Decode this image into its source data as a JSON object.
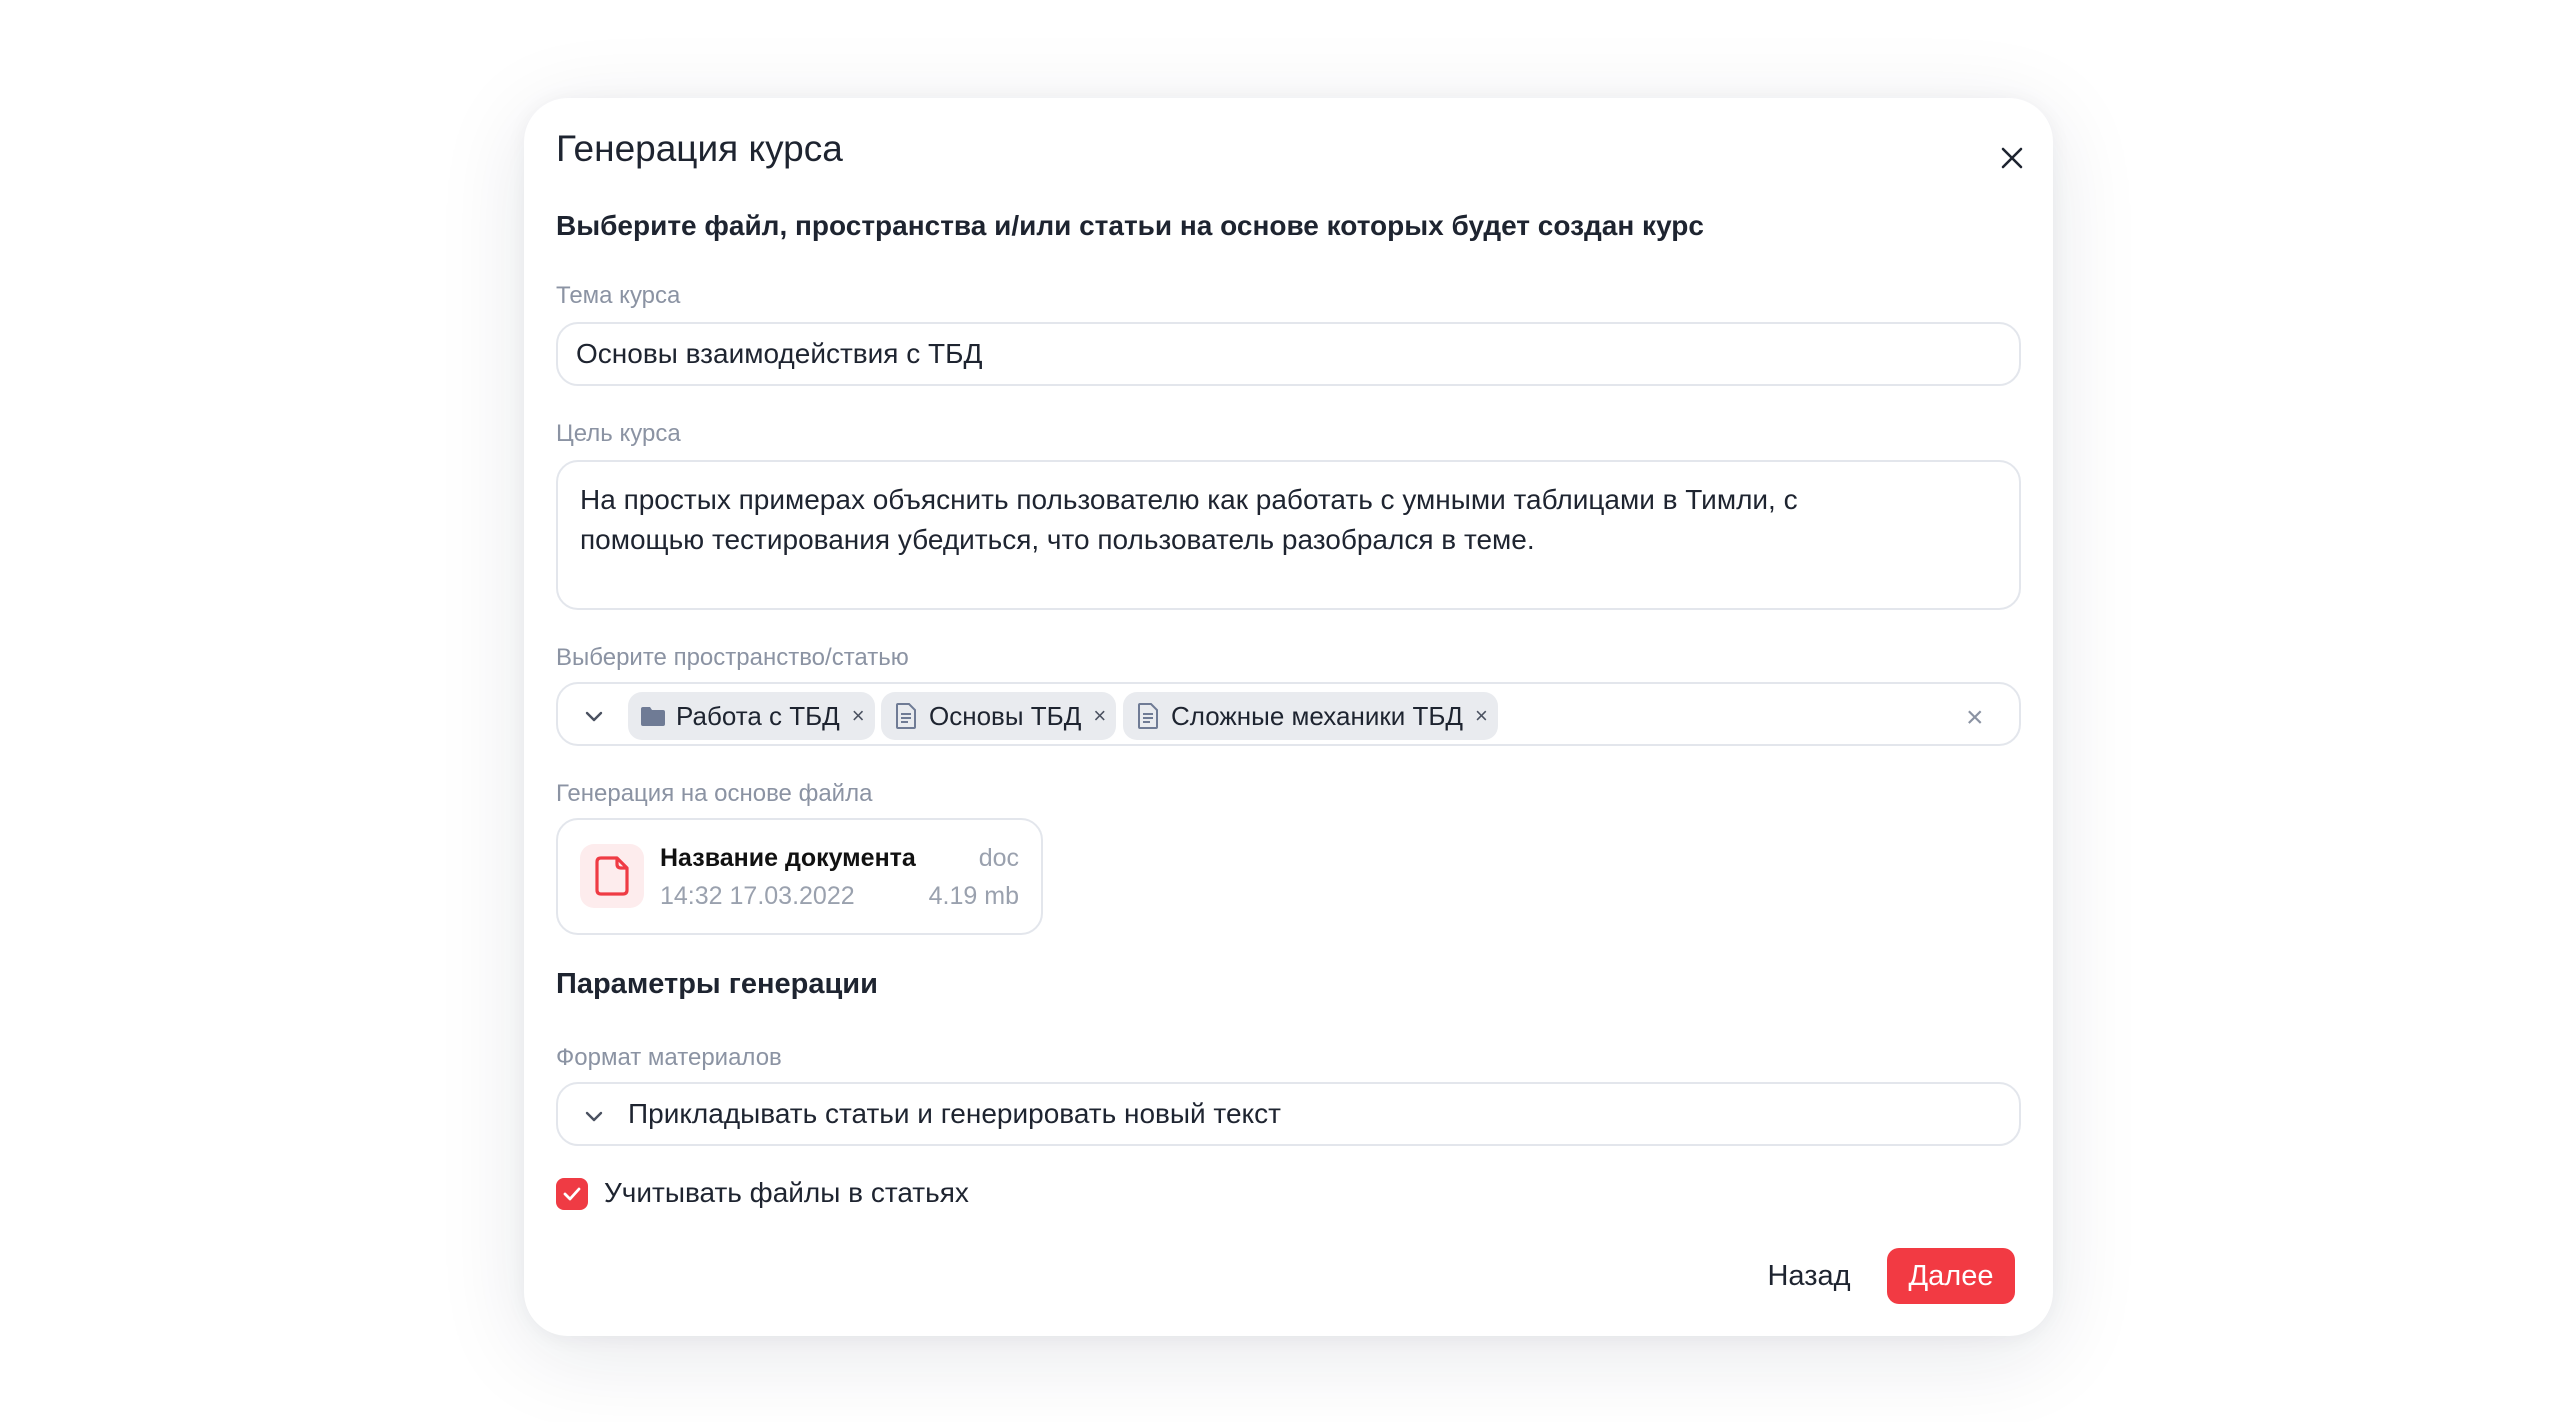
{
  "dialog": {
    "title": "Генерация курса",
    "subtitle": "Выберите файл, пространства и/или статьи на основе которых будет создан курс"
  },
  "topic": {
    "label": "Тема курса",
    "value": "Основы взаимодействия с ТБД"
  },
  "goal": {
    "label": "Цель курса",
    "value_line1": "На простых примерах объяснить пользователю как работать с умными таблицами в Тимли, с",
    "value_line2": "помощью тестирования убедиться, что пользователь разобрался в теме."
  },
  "space_select": {
    "label": "Выберите пространство/статью",
    "chips": [
      {
        "label": "Работа с ТБД",
        "icon": "folder-icon"
      },
      {
        "label": "Основы ТБД",
        "icon": "document-icon"
      },
      {
        "label": "Сложные механики ТБД",
        "icon": "document-icon"
      }
    ],
    "remove_glyph": "×",
    "clear_glyph": "×"
  },
  "file_section": {
    "label": "Генерация на основе файла",
    "file": {
      "name": "Название документа",
      "type": "doc",
      "datetime": "14:32 17.03.2022",
      "size": "4.19 mb"
    }
  },
  "params": {
    "title": "Параметры генерации",
    "format_label": "Формат материалов",
    "format_value": "Прикладывать статьи и генерировать новый текст",
    "checkbox_label": "Учитывать файлы в статьях",
    "checkbox_checked": true
  },
  "actions": {
    "back": "Назад",
    "next": "Далее"
  },
  "colors": {
    "accent": "#f23a43",
    "border": "#e3e6ec",
    "chip_bg": "#e9ebef",
    "muted_text": "#8b93a3"
  }
}
